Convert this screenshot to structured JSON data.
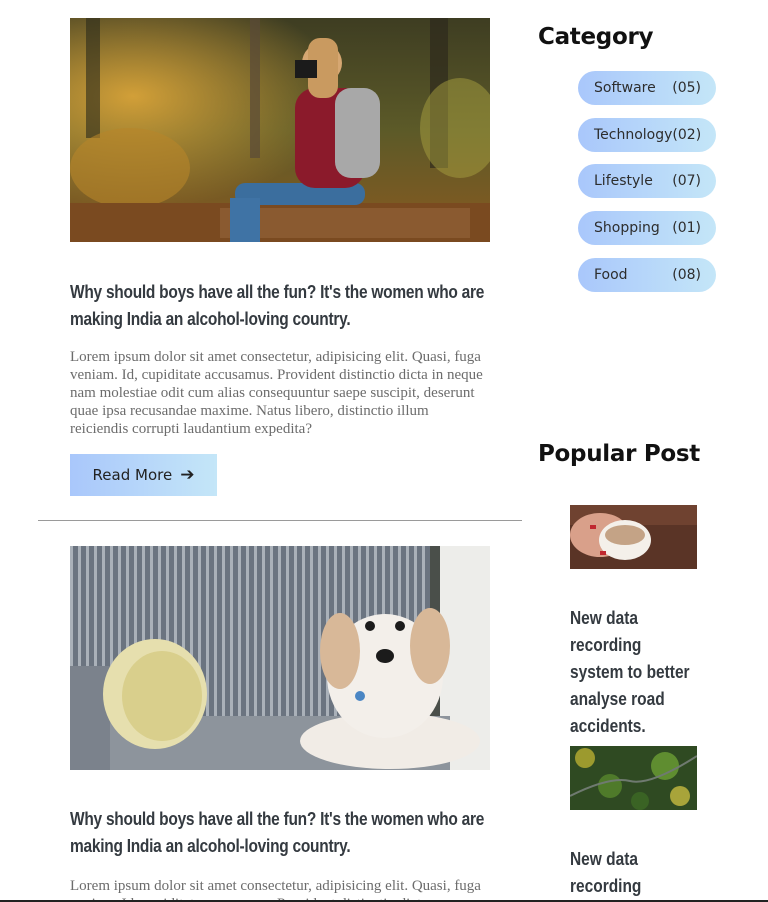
{
  "posts": [
    {
      "title": "Why should boys have all the fun? It's the women who are making India an alcohol-loving country.",
      "excerpt": "Lorem ipsum dolor sit amet consectetur, adipisicing elit. Quasi, fuga veniam. Id, cupiditate accusamus. Provident distinctio dicta in neque nam molestiae odit cum alias consequuntur saepe suscipit, deserunt quae ipsa recusandae maxime. Natus libero, distinctio illum reiciendis corrupti laudantium expedita?",
      "read_more": "Read More",
      "image": "woman-photographer-in-forest"
    },
    {
      "title": "Why should boys have all the fun? It's the women who are making India an alcohol-loving country.",
      "excerpt": "Lorem ipsum dolor sit amet consectetur, adipisicing elit. Quasi, fuga veniam. Id, cupiditate accusamus. Provident distinctio dicta",
      "image": "white-dog-on-striped-armchair"
    }
  ],
  "sidebar": {
    "category_heading": "Category",
    "categories": [
      {
        "label": "Software",
        "count": "(05)"
      },
      {
        "label": "Technology",
        "count": "(02)"
      },
      {
        "label": "Lifestyle",
        "count": "(07)"
      },
      {
        "label": "Shopping",
        "count": "(01)"
      },
      {
        "label": "Food",
        "count": "(08)"
      }
    ],
    "popular_heading": "Popular Post",
    "popular": [
      {
        "title": "New data recording system to better analyse road accidents.",
        "image": "hands-holding-coffee-cup"
      },
      {
        "title": "New data recording system",
        "image": "aerial-forest-road"
      }
    ]
  },
  "icons": {
    "read_more_arrow": "arrow-right-icon"
  },
  "colors": {
    "accent_start": "#a9c7fb",
    "accent_end": "#c4e6f8",
    "title": "#343a40"
  }
}
